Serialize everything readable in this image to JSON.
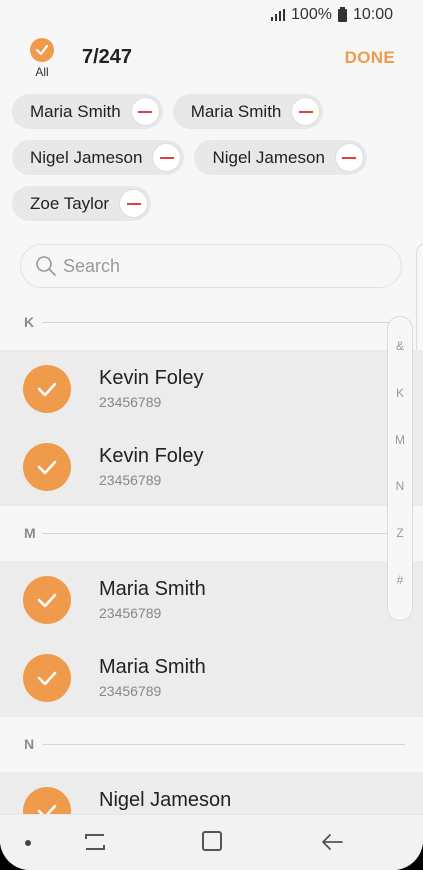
{
  "status_bar": {
    "battery": "100%",
    "time": "10:00"
  },
  "header": {
    "all_label": "All",
    "count": "7/247",
    "done_label": "DONE"
  },
  "selected_chips": [
    {
      "name": "Maria Smith"
    },
    {
      "name": "Maria Smith"
    },
    {
      "name": "Nigel Jameson"
    },
    {
      "name": "Nigel Jameson"
    },
    {
      "name": "Zoe Taylor"
    }
  ],
  "search": {
    "placeholder": "Search"
  },
  "sections": [
    {
      "letter": "K",
      "contacts": [
        {
          "name": "Kevin Foley",
          "phone": "23456789",
          "checked": true
        },
        {
          "name": "Kevin Foley",
          "phone": "23456789",
          "checked": true
        }
      ]
    },
    {
      "letter": "M",
      "contacts": [
        {
          "name": "Maria Smith",
          "phone": "23456789",
          "checked": true
        },
        {
          "name": "Maria Smith",
          "phone": "23456789",
          "checked": true
        }
      ]
    },
    {
      "letter": "N",
      "contacts": [
        {
          "name": "Nigel Jameson",
          "phone": "",
          "checked": true
        }
      ]
    }
  ],
  "index_letters": [
    "&",
    "K",
    "M",
    "N",
    "Z",
    "#"
  ],
  "colors": {
    "accent": "#f09a4c",
    "remove": "#e0403a"
  }
}
